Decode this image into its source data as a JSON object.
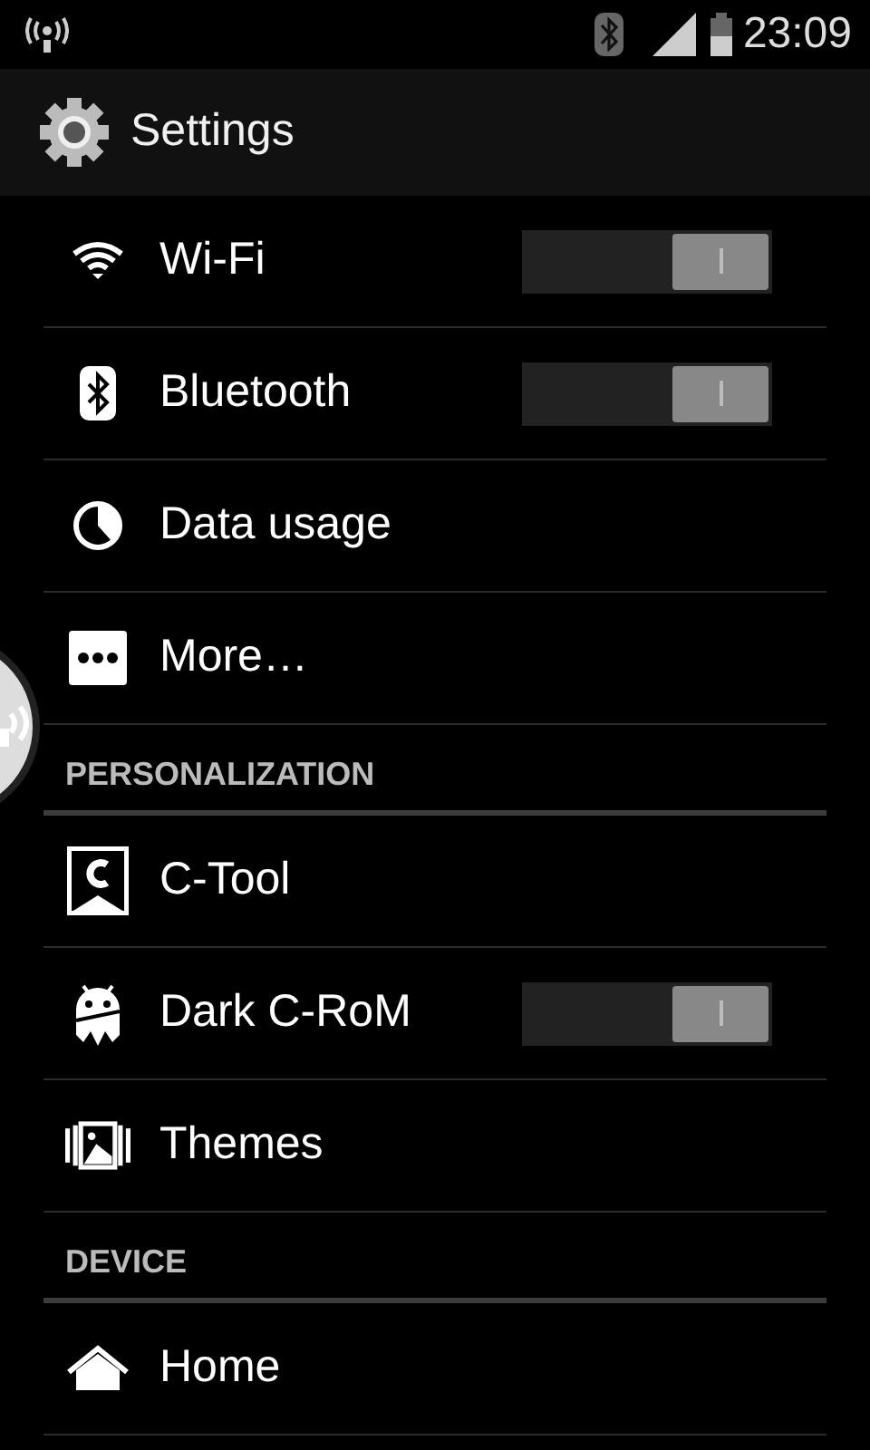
{
  "status_bar": {
    "time": "23:09"
  },
  "action_bar": {
    "title": "Settings"
  },
  "list": [
    {
      "kind": "switch",
      "label": "Wi-Fi",
      "on": true
    },
    {
      "kind": "link",
      "label": "Bluetooth",
      "on": true
    },
    {
      "kind": "link",
      "label": "Data usage"
    },
    {
      "kind": "link",
      "label": "More…"
    },
    {
      "kind": "header",
      "label": "PERSONALIZATION"
    },
    {
      "kind": "link",
      "label": "C-Tool"
    },
    {
      "kind": "link",
      "label": "Dark C-RoM",
      "on": true
    },
    {
      "kind": "link",
      "label": "Themes"
    },
    {
      "kind": "header",
      "label": "DEVICE"
    },
    {
      "kind": "link",
      "label": "Home"
    }
  ]
}
